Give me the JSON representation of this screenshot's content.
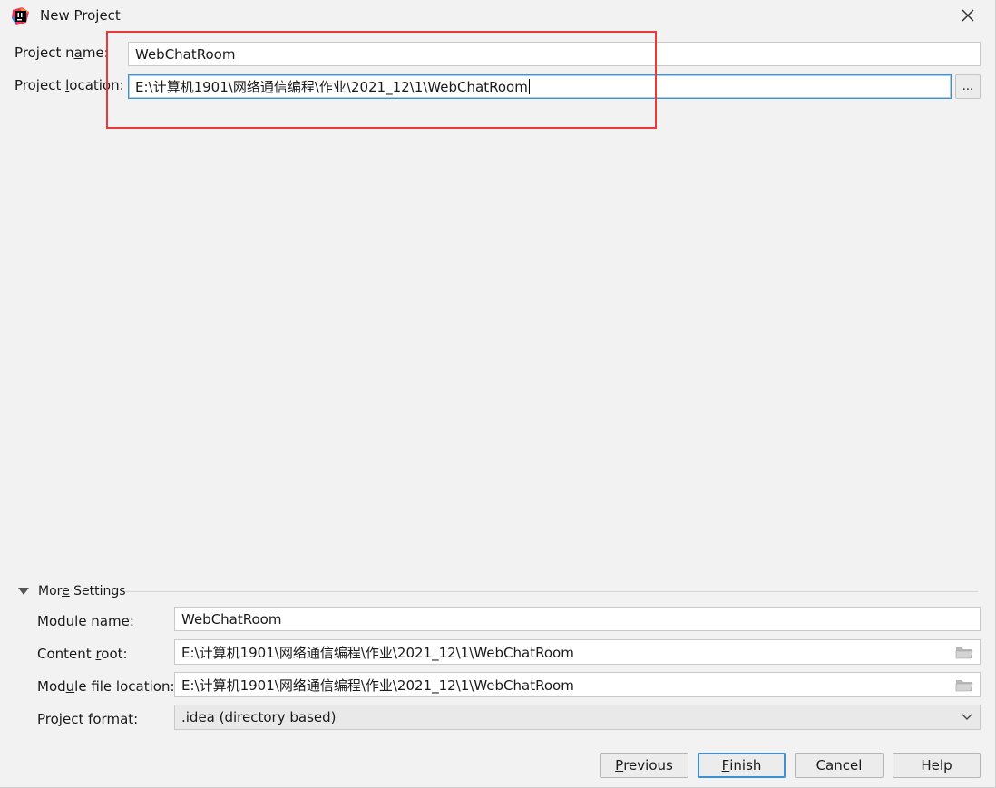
{
  "window": {
    "title": "New Project",
    "app_icon": "intellij-idea-icon",
    "close_icon": "close-icon"
  },
  "project": {
    "name_label_pre": "Project n",
    "name_label_mn": "a",
    "name_label_post": "me:",
    "name_value": "WebChatRoom",
    "location_label_pre": "Project ",
    "location_label_mn": "l",
    "location_label_post": "ocation:",
    "location_value": "E:\\计算机1901\\网络通信编程\\作业\\2021_12\\1\\WebChatRoom",
    "browse_label": "..."
  },
  "more_settings": {
    "toggle_label_pre": "Mor",
    "toggle_label_mn": "e",
    "toggle_label_post": " Settings",
    "expanded": true,
    "module_name_label_pre": "Module na",
    "module_name_label_mn": "m",
    "module_name_label_post": "e:",
    "module_name_value": "WebChatRoom",
    "content_root_label_pre": "Content ",
    "content_root_label_mn": "r",
    "content_root_label_post": "oot:",
    "content_root_value": "E:\\计算机1901\\网络通信编程\\作业\\2021_12\\1\\WebChatRoom",
    "module_file_label_pre": "Mod",
    "module_file_label_mn": "u",
    "module_file_label_post": "le file location:",
    "module_file_value": "E:\\计算机1901\\网络通信编程\\作业\\2021_12\\1\\WebChatRoom",
    "format_label_pre": "Project ",
    "format_label_mn": "f",
    "format_label_post": "ormat:",
    "format_value": ".idea (directory based)"
  },
  "buttons": {
    "previous_mn": "P",
    "previous_rest": "revious",
    "finish_mn": "F",
    "finish_rest": "inish",
    "cancel": "Cancel",
    "help": "Help"
  },
  "colors": {
    "annotation": "#e83a3a",
    "focus": "#3d8fd6",
    "background": "#f2f2f2"
  }
}
